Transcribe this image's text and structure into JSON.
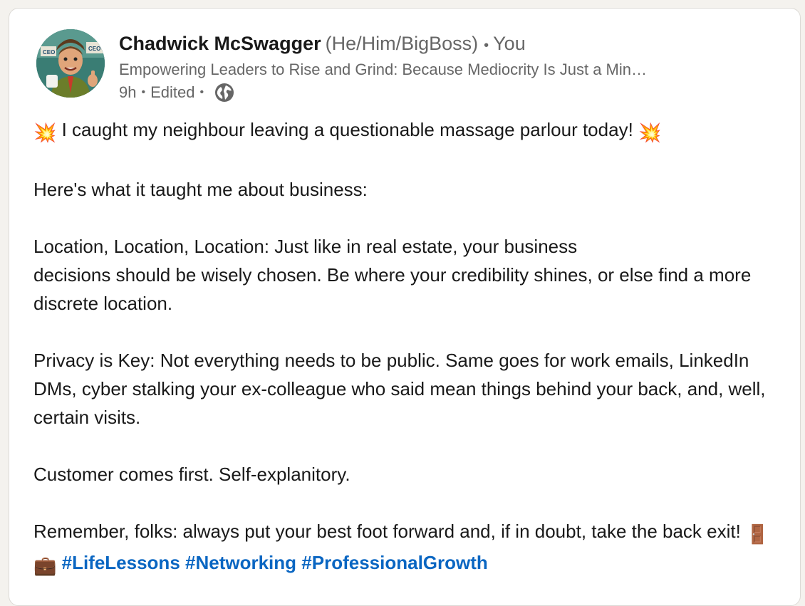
{
  "post": {
    "author": {
      "name": "Chadwick McSwagger",
      "pronouns": "(He/Him/BigBoss)",
      "degree": "You",
      "headline": "Empowering Leaders to Rise and Grind: Because Mediocrity Is Just a Min…",
      "avatar_badges": [
        "CEO",
        "CEO"
      ]
    },
    "meta": {
      "time": "9h",
      "edited": "Edited",
      "visibility_icon": "globe-icon"
    },
    "body": {
      "line1": "I caught my neighbour leaving a questionable massage parlour today!",
      "line1_emoji": "💥",
      "line2": "Here's what it taught me about business:",
      "para1": "Location, Location, Location: Just like in real estate, your business",
      "para1_cont": "decisions should be wisely chosen. Be where your credibility shines, or else find a more discrete location.",
      "para2": "Privacy is Key: Not everything needs to be public. Same goes for work emails, LinkedIn DMs, cyber stalking your ex-colleague who said mean things behind your back, and, well, certain visits.",
      "para3": "Customer comes first. Self-explanitory.",
      "para4": "Remember, folks: always put your best foot forward and, if in doubt, take the back exit!",
      "para4_emojis": [
        "🚪",
        "💼"
      ],
      "hashtags": [
        "#LifeLessons",
        "#Networking",
        "#ProfessionalGrowth"
      ]
    }
  },
  "colors": {
    "background": "#f4f2ee",
    "card": "#ffffff",
    "text": "#191919",
    "muted": "#666666",
    "link": "#0a66c2"
  }
}
